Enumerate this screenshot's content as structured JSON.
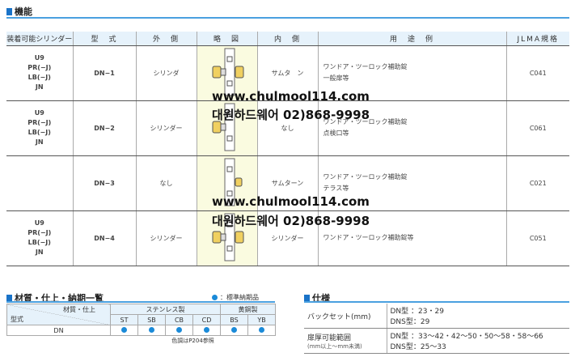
{
  "section1": {
    "title": "機能"
  },
  "columns": [
    "装着可能シリンダー",
    "型　式",
    "外　側",
    "略　図",
    "内　側",
    "用　途　例",
    "JLMA規格"
  ],
  "rows": [
    {
      "cylinders": [
        "U9",
        "PR(−J)",
        "LB(−J)",
        "JN"
      ],
      "model": "DN−1",
      "outside": "シリンダ",
      "inside": "サムタ　ン",
      "use": [
        "ワンドア・ツーロック補助錠",
        "一般扉等"
      ],
      "jlma": "C041"
    },
    {
      "cylinders": [
        "U9",
        "PR(−J)",
        "LB(−J)",
        "JN"
      ],
      "model": "DN−2",
      "outside": "シリンダー",
      "inside": "なし",
      "use": [
        "ワンドア・ツーロック補助錠",
        "点検口等"
      ],
      "jlma": "C061"
    },
    {
      "cylinders": [],
      "model": "DN−3",
      "outside": "なし",
      "inside": "サムターン",
      "use": [
        "ワンドア・ツーロック補助錠",
        "テラス等"
      ],
      "jlma": "C021"
    },
    {
      "cylinders": [
        "U9",
        "PR(−J)",
        "LB(−J)",
        "JN"
      ],
      "model": "DN−4",
      "outside": "シリンダー",
      "inside": "シリンダー",
      "use": [
        "ワンドア・ツーロック補助錠等"
      ],
      "jlma": "C051"
    }
  ],
  "watermarks": [
    {
      "url": "www.chulmool114.com",
      "text": "대원하드웨어 02)868-9998"
    },
    {
      "url": "www.chulmool114.com",
      "text": "대원하드웨어 02)868-9998"
    }
  ],
  "section2": {
    "title": "材質・仕上・納期一覧",
    "legend": "：標準納期品",
    "corner_top": "材質・仕上",
    "corner_bottom": "型式",
    "groups": [
      "ステンレス製",
      "黄銅製"
    ],
    "finishes": [
      "ST",
      "SB",
      "CB",
      "CD",
      "BS",
      "YB"
    ],
    "model": "DN",
    "note": "色調はP204参照"
  },
  "section3": {
    "title": "仕様",
    "rows": [
      {
        "label": "バックセット(mm)",
        "sub": "",
        "values": [
          "DN型 ：23・29",
          "DNS型：29"
        ]
      },
      {
        "label": "扉厚可能範囲",
        "sub": "(mm以上〜mm未満)",
        "values": [
          "DN型 ：33〜42・42〜50・50〜58・58〜66",
          "DNS型：25〜33"
        ]
      }
    ]
  }
}
